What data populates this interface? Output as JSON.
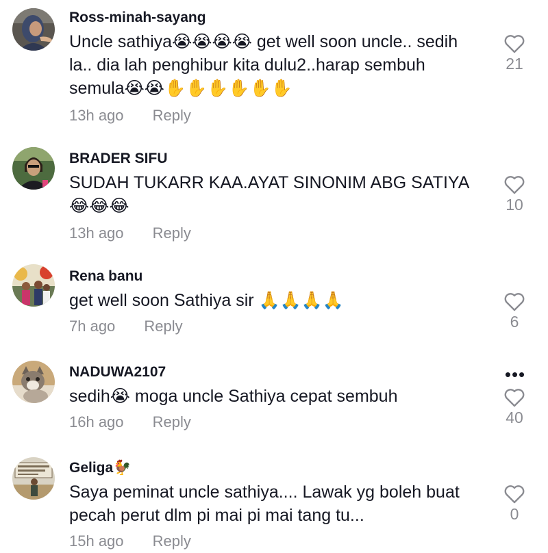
{
  "comments": [
    {
      "username": "Ross-minah-sayang",
      "text": "Uncle sathiya😭😭😭😭 get well soon uncle.. sedih la.. dia lah penghibur kita dulu2..harap sembuh semula😭😭✋✋✋✋✋✋",
      "time": "13h ago",
      "reply": "Reply",
      "likes": "21"
    },
    {
      "username": "BRADER SIFU",
      "text": "SUDAH TUKARR KAA.AYAT SINONIM ABG SATIYA 😂😂😂",
      "time": "13h ago",
      "reply": "Reply",
      "likes": "10"
    },
    {
      "username": "Rena banu",
      "text": "get well soon Sathiya sir 🙏🙏🙏🙏",
      "time": "7h ago",
      "reply": "Reply",
      "likes": "6"
    },
    {
      "username": "NADUWA2107",
      "text": "sedih😭 moga uncle Sathiya cepat sembuh",
      "time": "16h ago",
      "reply": "Reply",
      "likes": "40",
      "more": "•••"
    },
    {
      "username": "Geliga🐓",
      "text": "Saya peminat uncle sathiya.... Lawak yg boleh buat pecah perut dlm pi mai pi mai tang tu...",
      "time": "15h ago",
      "reply": "Reply",
      "likes": "0"
    }
  ],
  "icons": {
    "like": "heart-outline-icon",
    "more": "more-options-icon"
  },
  "colors": {
    "text": "#161823",
    "secondary": "#8a8b91",
    "background": "#ffffff"
  }
}
